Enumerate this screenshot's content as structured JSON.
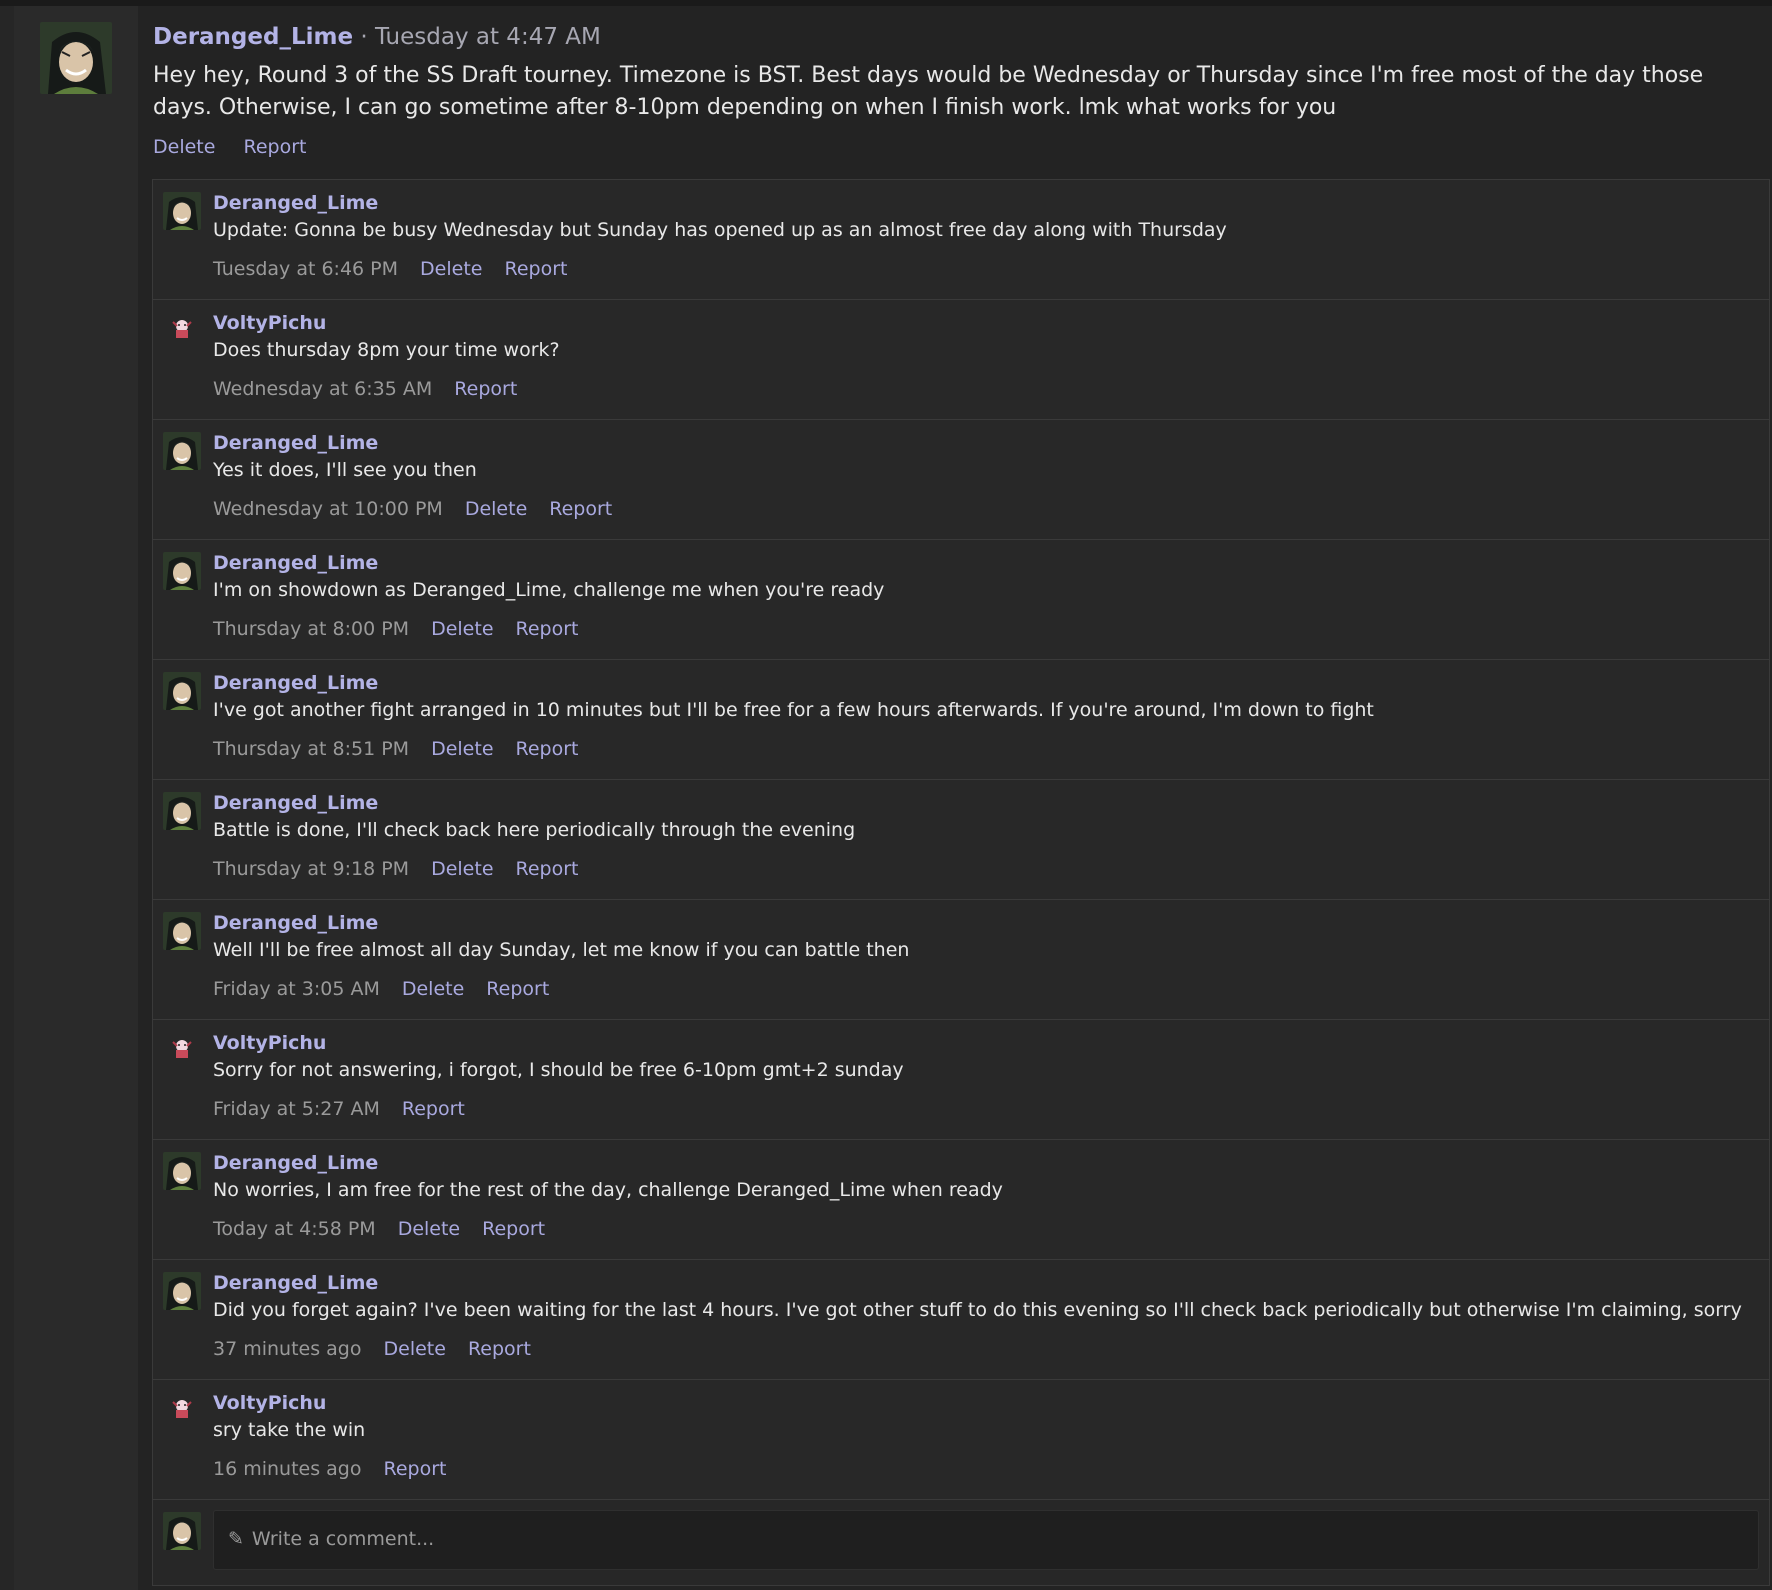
{
  "post": {
    "author": "Deranged_Lime",
    "separator": " · ",
    "time": "Tuesday at 4:47 AM",
    "text": "Hey hey, Round 3 of the SS Draft tourney. Timezone is BST. Best days would be Wednesday or Thursday since I'm free most of the day those days. Otherwise, I can go sometime after 8-10pm depending on when I finish work. lmk what works for you",
    "actions": [
      "Delete",
      "Report"
    ]
  },
  "comments": [
    {
      "author": "Deranged_Lime",
      "avatar": "toph-avatar",
      "text": "Update: Gonna be busy Wednesday but Sunday has opened up as an almost free day along with Thursday",
      "time": "Tuesday at 6:46 PM",
      "actions": [
        "Delete",
        "Report"
      ]
    },
    {
      "author": "VoltyPichu",
      "avatar": "pichu-avatar",
      "text": "Does thursday 8pm your time work?",
      "time": "Wednesday at 6:35 AM",
      "actions": [
        "Report"
      ]
    },
    {
      "author": "Deranged_Lime",
      "avatar": "toph-avatar",
      "text": "Yes it does, I'll see you then",
      "time": "Wednesday at 10:00 PM",
      "actions": [
        "Delete",
        "Report"
      ]
    },
    {
      "author": "Deranged_Lime",
      "avatar": "toph-avatar",
      "text": "I'm on showdown as Deranged_Lime, challenge me when you're ready",
      "time": "Thursday at 8:00 PM",
      "actions": [
        "Delete",
        "Report"
      ]
    },
    {
      "author": "Deranged_Lime",
      "avatar": "toph-avatar",
      "text": "I've got another fight arranged in 10 minutes but I'll be free for a few hours afterwards. If you're around, I'm down to fight",
      "time": "Thursday at 8:51 PM",
      "actions": [
        "Delete",
        "Report"
      ]
    },
    {
      "author": "Deranged_Lime",
      "avatar": "toph-avatar",
      "text": "Battle is done, I'll check back here periodically through the evening",
      "time": "Thursday at 9:18 PM",
      "actions": [
        "Delete",
        "Report"
      ]
    },
    {
      "author": "Deranged_Lime",
      "avatar": "toph-avatar",
      "text": "Well I'll be free almost all day Sunday, let me know if you can battle then",
      "time": "Friday at 3:05 AM",
      "actions": [
        "Delete",
        "Report"
      ]
    },
    {
      "author": "VoltyPichu",
      "avatar": "pichu-avatar",
      "text": "Sorry for not answering, i forgot, I should be free 6-10pm gmt+2 sunday",
      "time": "Friday at 5:27 AM",
      "actions": [
        "Report"
      ]
    },
    {
      "author": "Deranged_Lime",
      "avatar": "toph-avatar",
      "text": "No worries, I am free for the rest of the day, challenge Deranged_Lime when ready",
      "time": "Today at 4:58 PM",
      "actions": [
        "Delete",
        "Report"
      ]
    },
    {
      "author": "Deranged_Lime",
      "avatar": "toph-avatar",
      "text": "Did you forget again? I've been waiting for the last 4 hours. I've got other stuff to do this evening so I'll check back periodically but otherwise I'm claiming, sorry",
      "time": "37 minutes ago",
      "actions": [
        "Delete",
        "Report"
      ]
    },
    {
      "author": "VoltyPichu",
      "avatar": "pichu-avatar",
      "text": "sry take the win",
      "time": "16 minutes ago",
      "actions": [
        "Report"
      ]
    }
  ],
  "composer": {
    "placeholder": "Write a comment...",
    "icon": "pencil-icon"
  },
  "colors": {
    "link": "#a9a9df",
    "author": "#b3b3e6",
    "background": "#232323"
  }
}
